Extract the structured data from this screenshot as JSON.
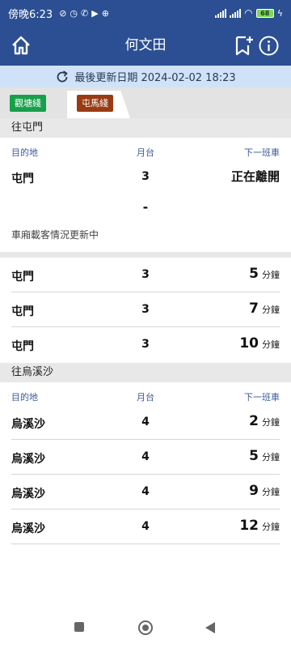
{
  "status_bar": {
    "time": "傍晚6:23",
    "battery": "68"
  },
  "app_bar": {
    "title": "何文田"
  },
  "update_banner": {
    "text": "最後更新日期 2024-02-02 18:23"
  },
  "line_tabs": [
    {
      "label": "觀塘綫",
      "color": "#17a04a",
      "active": false
    },
    {
      "label": "屯馬綫",
      "color": "#9a3a13",
      "active": true
    }
  ],
  "columns": {
    "destination": "目的地",
    "platform": "月台",
    "next_train": "下一班車"
  },
  "directions": [
    {
      "header": "往屯門",
      "first": {
        "destination": "屯門",
        "platform": "3",
        "status": "正在離開",
        "dash": "-",
        "occupancy": "車廂載客情況更新中"
      },
      "trains": [
        {
          "destination": "屯門",
          "platform": "3",
          "minutes": "5",
          "unit": "分鐘"
        },
        {
          "destination": "屯門",
          "platform": "3",
          "minutes": "7",
          "unit": "分鐘"
        },
        {
          "destination": "屯門",
          "platform": "3",
          "minutes": "10",
          "unit": "分鐘"
        }
      ]
    },
    {
      "header": "往烏溪沙",
      "trains": [
        {
          "destination": "烏溪沙",
          "platform": "4",
          "minutes": "2",
          "unit": "分鐘"
        },
        {
          "destination": "烏溪沙",
          "platform": "4",
          "minutes": "5",
          "unit": "分鐘"
        },
        {
          "destination": "烏溪沙",
          "platform": "4",
          "minutes": "9",
          "unit": "分鐘"
        },
        {
          "destination": "烏溪沙",
          "platform": "4",
          "minutes": "12",
          "unit": "分鐘"
        }
      ]
    }
  ],
  "colors": {
    "primary": "#2c4f93",
    "banner": "#cfe2f7",
    "section": "#e8e8e8"
  }
}
